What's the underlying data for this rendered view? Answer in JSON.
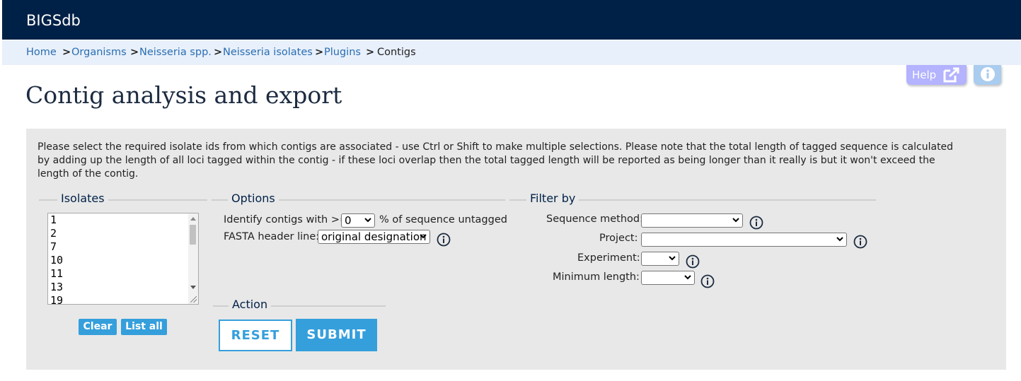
{
  "header": {
    "brand": "BIGSdb"
  },
  "breadcrumbs": [
    {
      "label": "Home"
    },
    {
      "label": "Organisms"
    },
    {
      "label": "Neisseria spp."
    },
    {
      "label": "Neisseria isolates"
    },
    {
      "label": "Plugins"
    },
    {
      "label": "Contigs"
    }
  ],
  "breadcrumb_separator": ">",
  "toolbar": {
    "help_label": "Help"
  },
  "page": {
    "title": "Contig analysis and export"
  },
  "intro": "Please select the required isolate ids from which contigs are associated - use Ctrl or Shift to make multiple selections. Please note that the total length of tagged sequence is calculated by adding up the length of all loci tagged within the contig - if these loci overlap then the total tagged length will be reported as being longer than it really is but it won't exceed the length of the contig.",
  "isolates": {
    "legend": "Isolates",
    "options": [
      "1",
      "2",
      "7",
      "10",
      "11",
      "13",
      "19"
    ],
    "clear_label": "Clear",
    "list_all_label": "List all"
  },
  "options": {
    "legend": "Options",
    "identify_prefix": "Identify contigs with >=",
    "identify_value": "0",
    "identify_suffix": "% of sequence untagged",
    "fasta_label": "FASTA header line:",
    "fasta_value": "original designation"
  },
  "filter": {
    "legend": "Filter by",
    "sequence_method_label": "Sequence method:",
    "project_label": "Project:",
    "experiment_label": "Experiment:",
    "minimum_length_label": "Minimum length:"
  },
  "action": {
    "legend": "Action",
    "reset_label": "RESET",
    "submit_label": "SUBMIT"
  },
  "colors": {
    "header_bg": "#002147",
    "breadcrumb_bg": "#e8f0fb",
    "panel_bg": "#e8e8e8",
    "accent": "#359fdc",
    "help_bg": "#b3b3ff",
    "info_bg": "#aaccee"
  }
}
